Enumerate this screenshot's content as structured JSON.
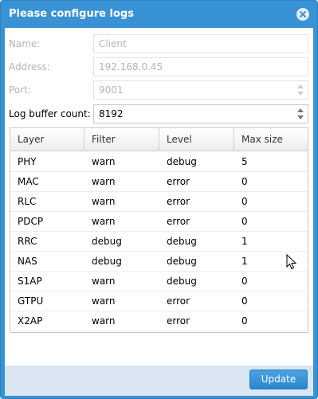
{
  "dialog": {
    "title": "Please configure logs"
  },
  "form": {
    "name": {
      "label": "Name:",
      "placeholder": "Client"
    },
    "address": {
      "label": "Address:",
      "placeholder": "192.168.0.45"
    },
    "port": {
      "label": "Port:",
      "placeholder": "9001"
    },
    "log_buffer": {
      "label": "Log buffer count:",
      "value": "8192"
    }
  },
  "grid": {
    "columns": [
      "Layer",
      "Filter",
      "Level",
      "Max size"
    ],
    "rows": [
      [
        "PHY",
        "warn",
        "debug",
        "5"
      ],
      [
        "MAC",
        "warn",
        "error",
        "0"
      ],
      [
        "RLC",
        "warn",
        "error",
        "0"
      ],
      [
        "PDCP",
        "warn",
        "error",
        "0"
      ],
      [
        "RRC",
        "debug",
        "debug",
        "1"
      ],
      [
        "NAS",
        "debug",
        "debug",
        "1"
      ],
      [
        "S1AP",
        "warn",
        "debug",
        "0"
      ],
      [
        "GTPU",
        "warn",
        "error",
        "0"
      ],
      [
        "X2AP",
        "warn",
        "error",
        "0"
      ]
    ]
  },
  "footer": {
    "update_label": "Update"
  },
  "icons": {
    "close": "close-icon",
    "cursor": "mouse-pointer-icon"
  }
}
